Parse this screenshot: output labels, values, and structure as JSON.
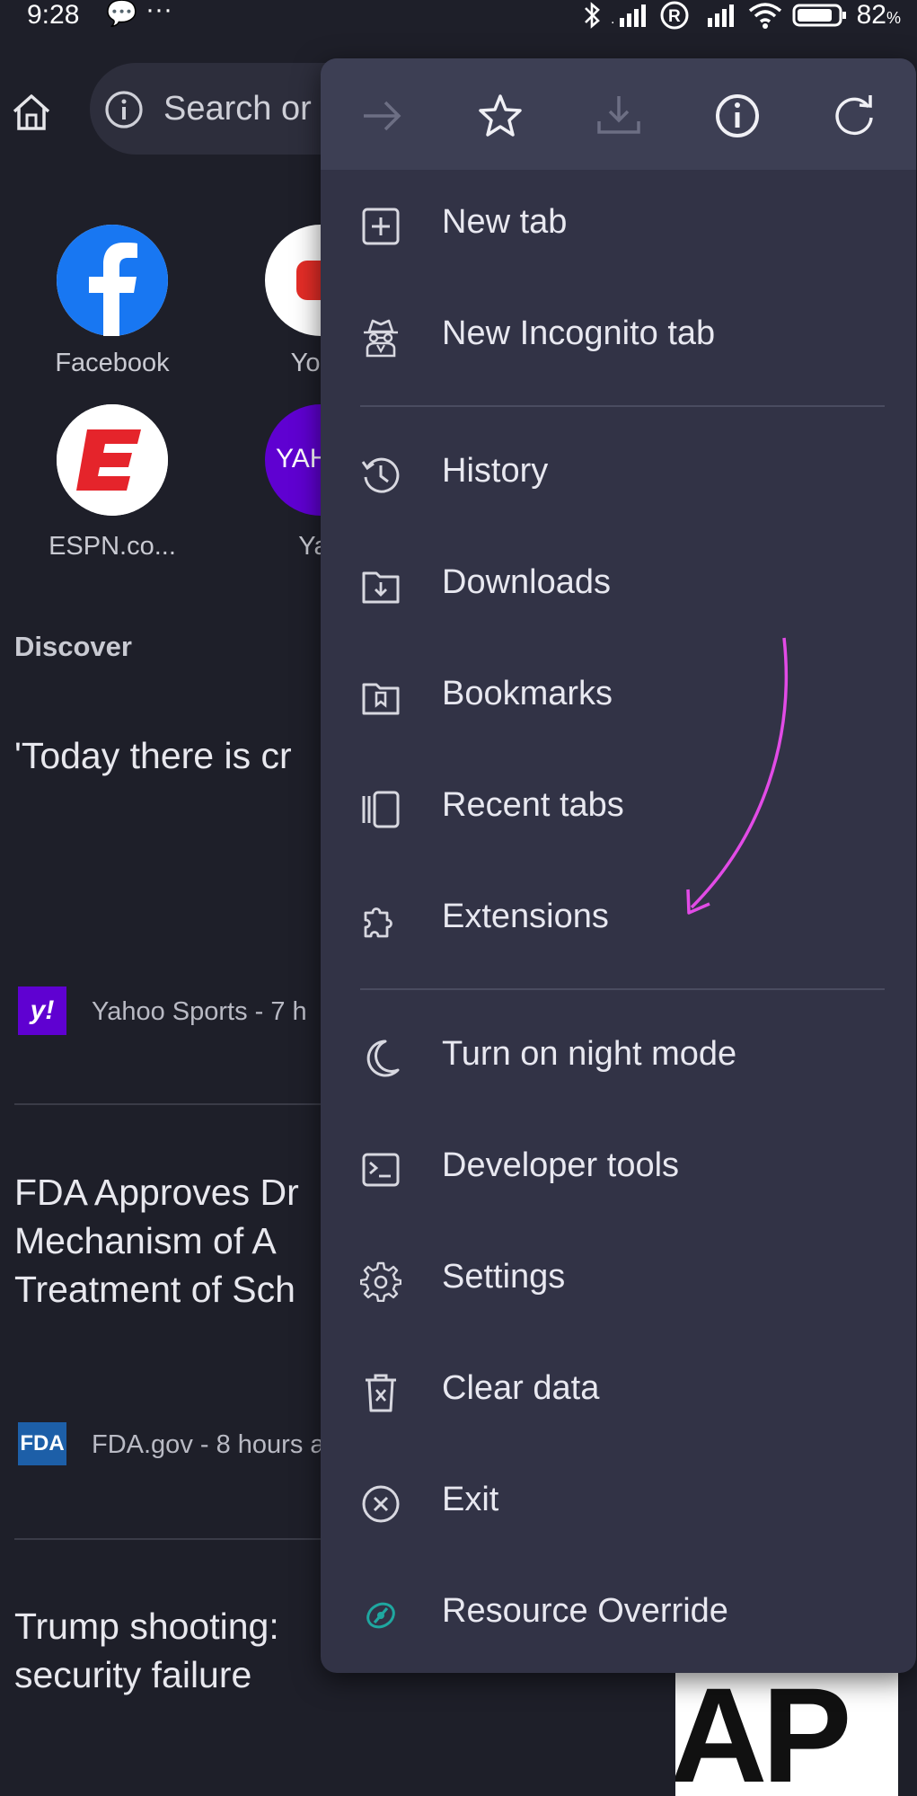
{
  "status_bar": {
    "time": "9:28",
    "chat_glyph": "💬",
    "dots": "···",
    "battery": "82",
    "battery_unit": "%"
  },
  "toolbar": {
    "home_icon": "home-icon",
    "omnibox_text": "Search or"
  },
  "shortcuts": [
    {
      "label": "Facebook",
      "icon": "facebook-icon"
    },
    {
      "label": "YouT",
      "icon": "youtube-icon"
    },
    {
      "label": "ESPN.co...",
      "icon": "espn-icon"
    },
    {
      "label": "Yah",
      "icon": "yahoo-icon"
    }
  ],
  "feed": {
    "section_title": "Discover",
    "articles": [
      {
        "headline": "'Today there is cr",
        "source": "Yahoo Sports - 7 h",
        "source_badge": "y!"
      },
      {
        "headline_lines": [
          "FDA Approves Dr",
          "Mechanism of A",
          "Treatment of Sch"
        ],
        "source": "FDA.gov - 8 hours a",
        "source_badge": "FDA"
      },
      {
        "headline_lines": [
          "Trump shooting:",
          "security failure"
        ],
        "thumbnail_text": "AP"
      }
    ]
  },
  "menu": {
    "actions": [
      {
        "name": "forward",
        "icon": "arrow-right-icon",
        "enabled": false
      },
      {
        "name": "bookmark",
        "icon": "star-icon",
        "enabled": true
      },
      {
        "name": "download",
        "icon": "download-icon",
        "enabled": false
      },
      {
        "name": "page-info",
        "icon": "info-icon",
        "enabled": true
      },
      {
        "name": "reload",
        "icon": "reload-icon",
        "enabled": true
      }
    ],
    "items": [
      {
        "label": "New tab",
        "icon": "plus-square-icon"
      },
      {
        "label": "New Incognito tab",
        "icon": "incognito-icon"
      },
      {
        "label": "History",
        "icon": "history-icon"
      },
      {
        "label": "Downloads",
        "icon": "downloads-folder-icon"
      },
      {
        "label": "Bookmarks",
        "icon": "bookmarks-folder-icon"
      },
      {
        "label": "Recent tabs",
        "icon": "recent-tabs-icon"
      },
      {
        "label": "Extensions",
        "icon": "puzzle-icon"
      },
      {
        "label": "Turn on night mode",
        "icon": "moon-icon"
      },
      {
        "label": "Developer tools",
        "icon": "terminal-icon"
      },
      {
        "label": "Settings",
        "icon": "gear-icon"
      },
      {
        "label": "Clear data",
        "icon": "trash-icon"
      },
      {
        "label": "Exit",
        "icon": "close-circle-icon"
      },
      {
        "label": "Resource Override",
        "icon": "resource-override-icon"
      }
    ]
  },
  "colors": {
    "background": "#1e1f29",
    "menu_bg": "#323346",
    "menu_action_bar": "#3d3f54",
    "annotation_arrow": "#e24be6",
    "facebook": "#1877f2",
    "espn": "#e5242b",
    "yahoo": "#5f01d1"
  }
}
